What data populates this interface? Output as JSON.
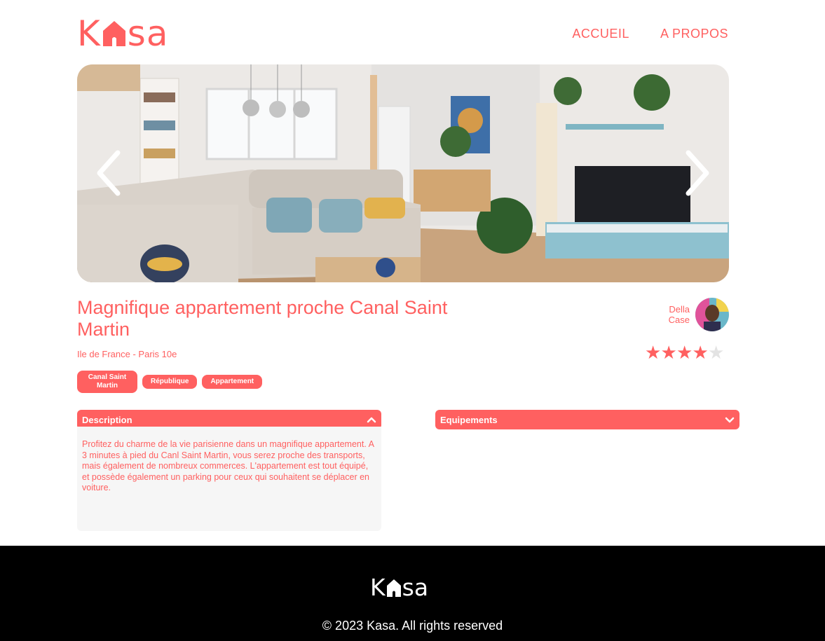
{
  "header": {
    "logo_left": "K",
    "logo_right": "sa",
    "nav": [
      "ACCUEIL",
      "A PROPOS"
    ]
  },
  "carousel": {
    "prev_icon": "chevron-left-icon",
    "next_icon": "chevron-right-icon"
  },
  "listing": {
    "title": "Magnifique appartement proche Canal Saint Martin",
    "location": "Ile de France - Paris 10e",
    "tags": [
      "Canal Saint Martin",
      "République",
      "Appartement"
    ],
    "host": {
      "first_name": "Della",
      "last_name": "Case"
    },
    "rating": 4,
    "rating_max": 5
  },
  "collapses": {
    "description": {
      "title": "Description",
      "text": "Profitez du charme de la vie parisienne dans un magnifique appartement. A 3 minutes à pied du Canl Saint Martin, vous serez proche des transports, mais également de nombreux commerces. L'appartement est tout équipé, et possède également un parking pour ceux qui souhaitent se déplacer en voiture.",
      "icon": "chevron-up-icon"
    },
    "equipments": {
      "title": "Equipements",
      "icon": "chevron-down-icon"
    }
  },
  "footer": {
    "logo_left": "K",
    "logo_right": "sa",
    "copyright": "© 2023 Kasa. All rights reserved"
  },
  "colors": {
    "accent": "#FF6060",
    "background": "#FFFFFF",
    "panel": "#F6F6F6",
    "footer": "#000000",
    "star_off": "#E3E3E3"
  }
}
